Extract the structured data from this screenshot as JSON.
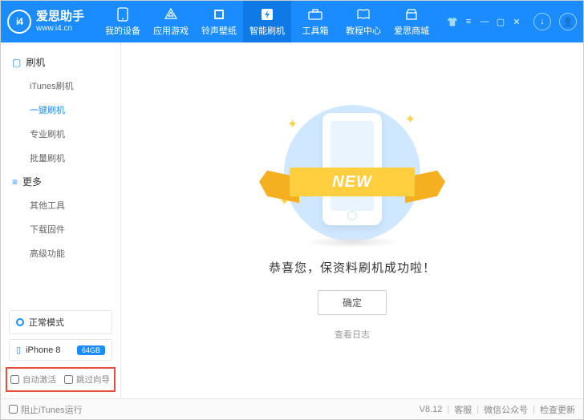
{
  "logo": {
    "badge": "i4",
    "title": "爱思助手",
    "subtitle": "www.i4.cn"
  },
  "nav": [
    {
      "label": "我的设备",
      "icon": "phone"
    },
    {
      "label": "应用游戏",
      "icon": "apps"
    },
    {
      "label": "铃声壁纸",
      "icon": "music"
    },
    {
      "label": "智能刷机",
      "icon": "flash",
      "active": true
    },
    {
      "label": "工具箱",
      "icon": "toolbox"
    },
    {
      "label": "教程中心",
      "icon": "book"
    },
    {
      "label": "爱思商城",
      "icon": "shop"
    }
  ],
  "sidebar": {
    "section1_title": "刷机",
    "section1": [
      "iTunes刷机",
      "一键刷机",
      "专业刷机",
      "批量刷机"
    ],
    "active1": 1,
    "section2_title": "更多",
    "section2": [
      "其他工具",
      "下载固件",
      "高级功能"
    ],
    "mode_label": "正常模式",
    "device_name": "iPhone 8",
    "device_capacity": "64GB",
    "chk_auto": "自动激活",
    "chk_skip": "跳过向导"
  },
  "main": {
    "ribbon_text": "NEW",
    "success_text": "恭喜您，保资料刷机成功啦！",
    "ok_label": "确定",
    "view_log": "查看日志"
  },
  "footer": {
    "block_itunes": "阻止iTunes运行",
    "version": "V8.12",
    "support": "客服",
    "wechat": "微信公众号",
    "update": "检查更新"
  }
}
